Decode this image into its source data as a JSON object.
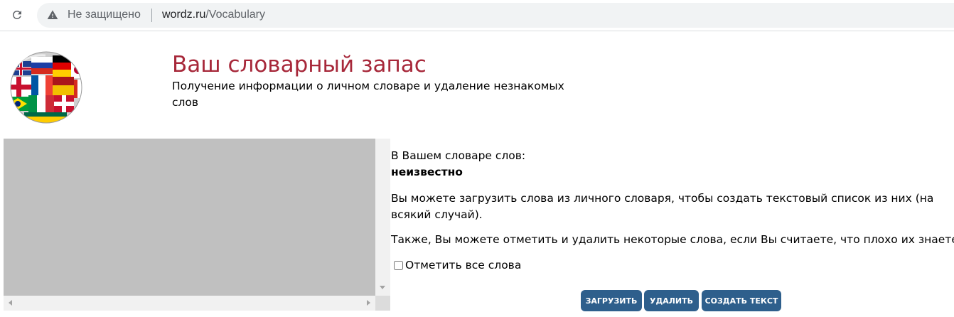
{
  "browser": {
    "security_label": "Не защищено",
    "url_host": "wordz.ru",
    "url_path": "/Vocabulary",
    "icons": {
      "reload": "reload-icon",
      "warning": "warning-icon"
    }
  },
  "header": {
    "title": "Ваш словарный запас",
    "subtitle": "Получение информации о личном словаре и удаление незнакомых слов"
  },
  "vocabulary": {
    "count_label": "В Вашем словаре слов:",
    "count_value": "неизвестно",
    "description_load": "Вы можете загрузить слова из личного словаря, чтобы создать текстовый список из них (на всякий случай).",
    "description_delete": "Также, Вы можете отметить и удалить некоторые слова, если Вы считаете, что плохо их знаете.",
    "select_all_label": "Отметить все слова",
    "select_all_checked": false
  },
  "actions": {
    "load_label": "ЗАГРУЗИТЬ",
    "delete_label": "УДАЛИТЬ",
    "create_text_label": "СОЗДАТЬ ТЕКСТ"
  },
  "colors": {
    "title": "#a7283a",
    "button": "#2e5f8c",
    "wordlist_background": "#c0c0c0"
  }
}
